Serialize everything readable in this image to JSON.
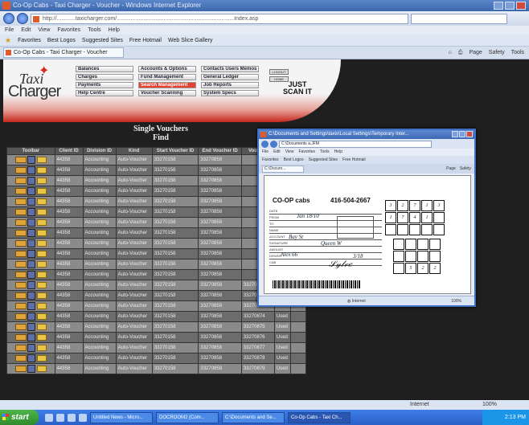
{
  "browser": {
    "title": "Co-Op Cabs - Taxi Charger - Voucher - Windows Internet Explorer",
    "address": "http://............taxicharger.com/...........................................................................Index.asp",
    "search_placeholder": "",
    "menu": [
      "File",
      "Edit",
      "View",
      "Favorites",
      "Tools",
      "Help"
    ],
    "favorites": {
      "label": "Favorites",
      "items": [
        "Best Logos",
        "Suggested Sites",
        "Free Hotmail",
        "Web Slice Gallery"
      ]
    },
    "tab_label": "Co-Op Cabs - Taxi Charger - Voucher",
    "commands": [
      "Page",
      "Safety",
      "Tools"
    ],
    "status_zone": "Internet",
    "status_zoom": "100%"
  },
  "app": {
    "logo_top": "Taxi",
    "logo_bottom": "Charger",
    "tagline_1": "JUST",
    "tagline_2": "SCAN IT",
    "nav": [
      "Balances",
      "Accounts & Options",
      "Contacts Users Memos",
      "Charges",
      "Fund Management",
      "General Ledger",
      "Payments",
      "Search Management",
      "Job Reports",
      "Help Centre",
      "Voucher Scanning",
      "System Specs"
    ],
    "active_nav_index": 7,
    "small_buttons": [
      "LOGOUT",
      "HOME"
    ],
    "page_title": "Single Vouchers",
    "page_subtitle": "Find"
  },
  "table": {
    "headers": [
      "Toolbar",
      "Client ID",
      "Division ID",
      "Kind",
      "Start Voucher ID",
      "End Voucher ID",
      "Voucher",
      "",
      ""
    ],
    "rows": [
      [
        "44358",
        "Accounting",
        "Auto-Voucher",
        "33270158",
        "33270858",
        "",
        "",
        ""
      ],
      [
        "44358",
        "Accounting",
        "Auto-Voucher",
        "33270158",
        "33270858",
        "",
        "",
        ""
      ],
      [
        "44358",
        "Accounting",
        "Auto-Voucher",
        "33270158",
        "33270858",
        "",
        "",
        ""
      ],
      [
        "44358",
        "Accounting",
        "Auto-Voucher",
        "33270158",
        "33270858",
        "",
        "",
        ""
      ],
      [
        "44358",
        "Accounting",
        "Auto-Voucher",
        "33270158",
        "33270858",
        "",
        "",
        ""
      ],
      [
        "44358",
        "Accounting",
        "Auto-Voucher",
        "33270158",
        "33270858",
        "",
        "",
        ""
      ],
      [
        "44358",
        "Accounting",
        "Auto-Voucher",
        "33270158",
        "33270858",
        "",
        "",
        ""
      ],
      [
        "44358",
        "Accounting",
        "Auto-Voucher",
        "33270158",
        "33270858",
        "",
        "",
        ""
      ],
      [
        "44358",
        "Accounting",
        "Auto-Voucher",
        "33270158",
        "33270858",
        "",
        "",
        ""
      ],
      [
        "44358",
        "Accounting",
        "Auto-Voucher",
        "33270158",
        "33270858",
        "",
        "",
        ""
      ],
      [
        "44358",
        "Accounting",
        "Auto-Voucher",
        "33270158",
        "33270858",
        "",
        "",
        ""
      ],
      [
        "44358",
        "Accounting",
        "Auto-Voucher",
        "33270158",
        "33270858",
        "",
        "",
        ""
      ],
      [
        "44358",
        "Accounting",
        "Auto-Voucher",
        "33270158",
        "33270858",
        "33270871",
        "Used",
        ""
      ],
      [
        "44358",
        "Accounting",
        "Auto-Voucher",
        "33270158",
        "33270858",
        "33270872",
        "Used",
        ""
      ],
      [
        "44358",
        "Accounting",
        "Auto-Voucher",
        "33270158",
        "33270858",
        "33270873",
        "Used",
        ""
      ],
      [
        "44358",
        "Accounting",
        "Auto-Voucher",
        "33270158",
        "33270858",
        "33270874",
        "Used",
        ""
      ],
      [
        "44358",
        "Accounting",
        "Auto-Voucher",
        "33270158",
        "33270858",
        "33270875",
        "Used",
        ""
      ],
      [
        "44358",
        "Accounting",
        "Auto-Voucher",
        "33270158",
        "33270858",
        "33270876",
        "Used",
        ""
      ],
      [
        "44358",
        "Accounting",
        "Auto-Voucher",
        "33270158",
        "33270858",
        "33270877",
        "Used",
        ""
      ],
      [
        "44358",
        "Accounting",
        "Auto-Voucher",
        "33270158",
        "33270858",
        "33270878",
        "Used",
        ""
      ],
      [
        "44358",
        "Accounting",
        "Auto-Voucher",
        "33270158",
        "33270858",
        "33270879",
        "Used",
        ""
      ]
    ]
  },
  "popup": {
    "title": "C:\\Documents and Settings\\taxis\\Local Settings\\Temporary Inter...",
    "address": "C:\\Documents a.JFM",
    "menu": [
      "File",
      "Edit",
      "View",
      "Favorites",
      "Tools",
      "Help"
    ],
    "favorites": [
      "Favorites",
      "Best Logos",
      "Suggested Sites",
      "Free Hotmail"
    ],
    "tab": "C:\\Docum...",
    "commands": [
      "Page",
      "Safety"
    ],
    "status_zone": "Internet",
    "status_zoom": "100%",
    "voucher": {
      "company": "CO-OP cabs",
      "phone": "416-504-2667",
      "field_labels": [
        "DATE",
        "FROM",
        "TO",
        "NAME",
        "ACCOUNT",
        "SIGNATURE",
        "AMOUNT",
        "DRIVER",
        "CAB"
      ],
      "handwriting": [
        "Jan 18/10",
        "Bay St",
        "Queen W",
        "Alex 66",
        "3/18"
      ],
      "grid_top": [
        "3",
        "2",
        "7",
        "1",
        "3",
        "1",
        "7",
        "4",
        "1",
        "",
        "",
        "",
        "",
        "",
        ""
      ],
      "grid_bottom": [
        "",
        "",
        "",
        "",
        "",
        "",
        "",
        "",
        "",
        "5",
        "2",
        "2"
      ]
    }
  },
  "taskbar": {
    "start": "start",
    "items": [
      "Untitled News - Micro...",
      "DOCROOM2 (Com...",
      "C:\\Documents and Se...",
      "Co-Op Cabs - Taxi Ch..."
    ],
    "active_index": 3,
    "clock": "2:13 PM"
  },
  "colors": {
    "brand_red": "#d52b1e",
    "active_nav": "#e8412f",
    "page_bg": "#1f1f1f"
  }
}
